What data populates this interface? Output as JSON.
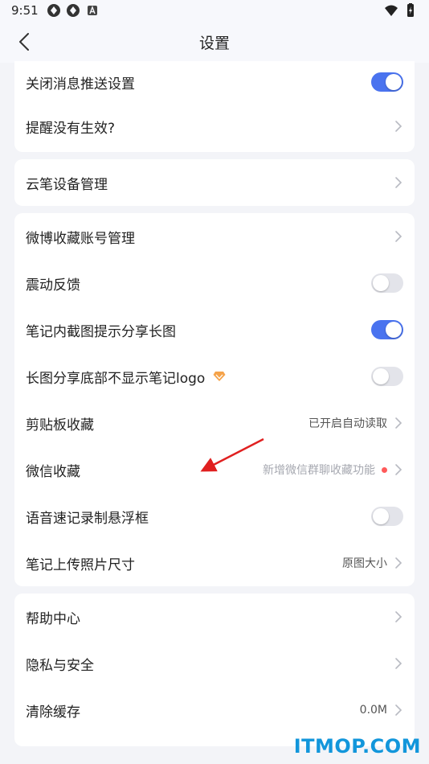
{
  "status_bar": {
    "time": "9:51"
  },
  "header": {
    "title": "设置"
  },
  "card1": {
    "push_label": "关闭消息推送设置",
    "push_on": true,
    "reminder_label": "提醒没有生效?"
  },
  "card2": {
    "pen_label": "云笔设备管理"
  },
  "card3": {
    "weibo_label": "微博收藏账号管理",
    "vibration_label": "震动反馈",
    "vibration_on": false,
    "share_long_label": "笔记内截图提示分享长图",
    "share_long_on": true,
    "logo_label": "长图分享底部不显示笔记logo",
    "logo_on": false,
    "clipboard_label": "剪贴板收藏",
    "clipboard_value": "已开启自动读取",
    "wechat_label": "微信收藏",
    "wechat_value": "新增微信群聊收藏功能",
    "voice_label": "语音速记录制悬浮框",
    "voice_on": false,
    "photo_label": "笔记上传照片尺寸",
    "photo_value": "原图大小"
  },
  "card4": {
    "help_label": "帮助中心",
    "privacy_label": "隐私与安全",
    "cache_label": "清除缓存",
    "cache_value": "0.0M"
  },
  "colors": {
    "accent": "#4a73ef",
    "badge": "#ff5a5a",
    "vip": "#f5a34a"
  },
  "watermark": "ITMOP.COM"
}
